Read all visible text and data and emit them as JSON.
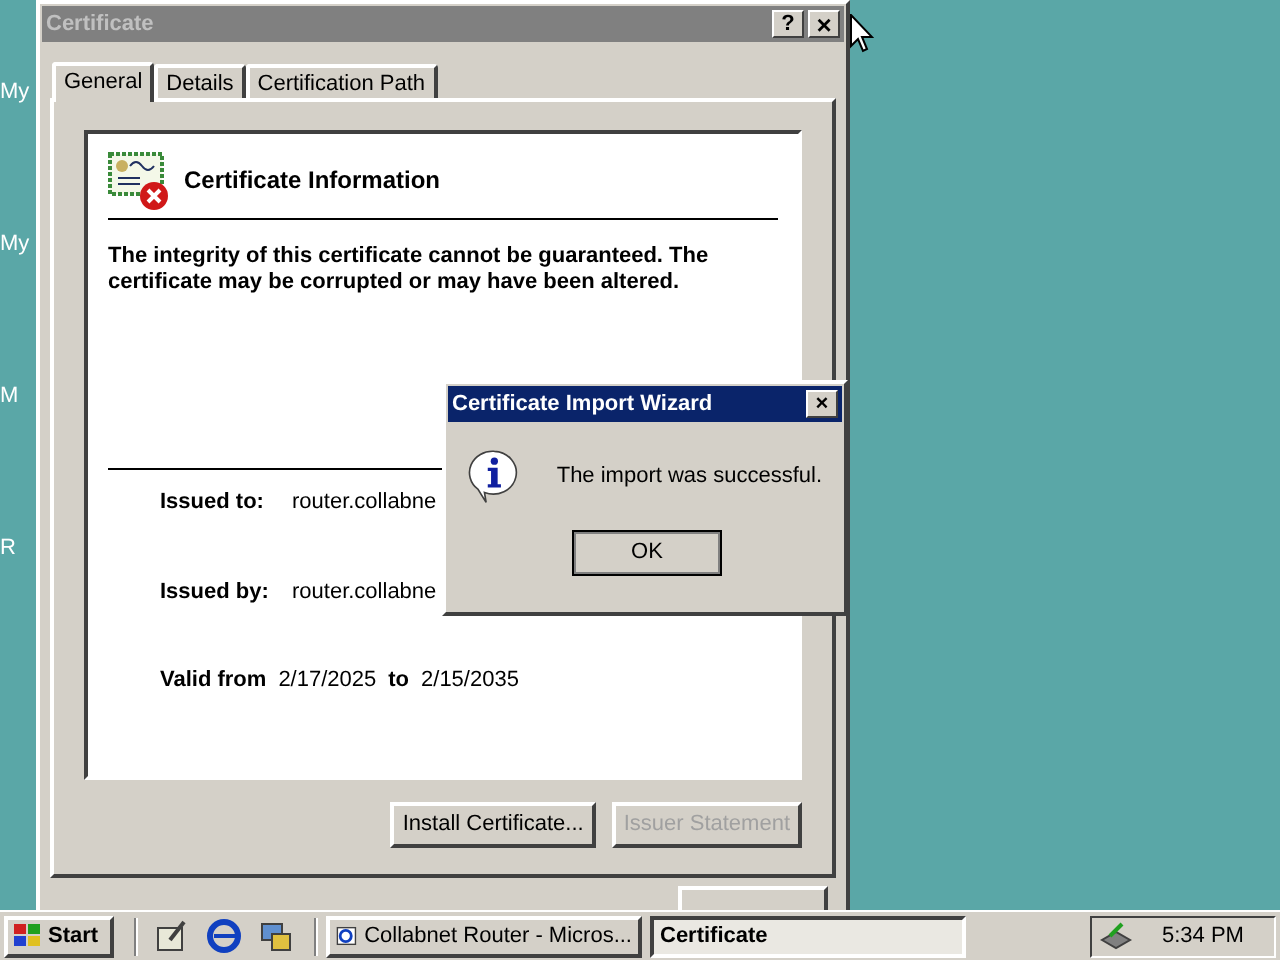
{
  "desktop_icons": [
    {
      "label": "My"
    },
    {
      "label": "My"
    },
    {
      "label": "M"
    },
    {
      "label": "R"
    }
  ],
  "certificate_window": {
    "title": "Certificate",
    "title_buttons": [
      {
        "kind": "help",
        "label": "?"
      },
      {
        "kind": "close",
        "label": "×"
      }
    ],
    "tabs": [
      {
        "label": "General",
        "selected": true
      },
      {
        "label": "Details",
        "selected": false
      },
      {
        "label": "Certification Path",
        "selected": false
      }
    ],
    "header": "Certificate Information",
    "warning": "The integrity of this certificate cannot be guaranteed. The certificate may be corrupted or may have been altered.",
    "fields": [
      {
        "label": "Issued to:",
        "value": "router.collabne"
      },
      {
        "label": "Issued by:",
        "value": "router.collabne"
      }
    ],
    "validity": {
      "from_label": "Valid from",
      "from": "2/17/2025",
      "to_label": "to",
      "to": "2/15/2035"
    },
    "buttons": [
      {
        "label": "Install Certificate...",
        "disabled": false
      },
      {
        "label": "Issuer Statement",
        "disabled": true
      }
    ]
  },
  "dialog": {
    "title": "Certificate Import Wizard",
    "close": "×",
    "message": "The import was successful.",
    "ok": "OK"
  },
  "taskbar": {
    "start": "Start",
    "tasks": [
      {
        "label": "Collabnet Router - Micros...",
        "selected": false
      },
      {
        "label": "Certificate",
        "selected": true
      }
    ],
    "clock": "5:34 PM"
  }
}
